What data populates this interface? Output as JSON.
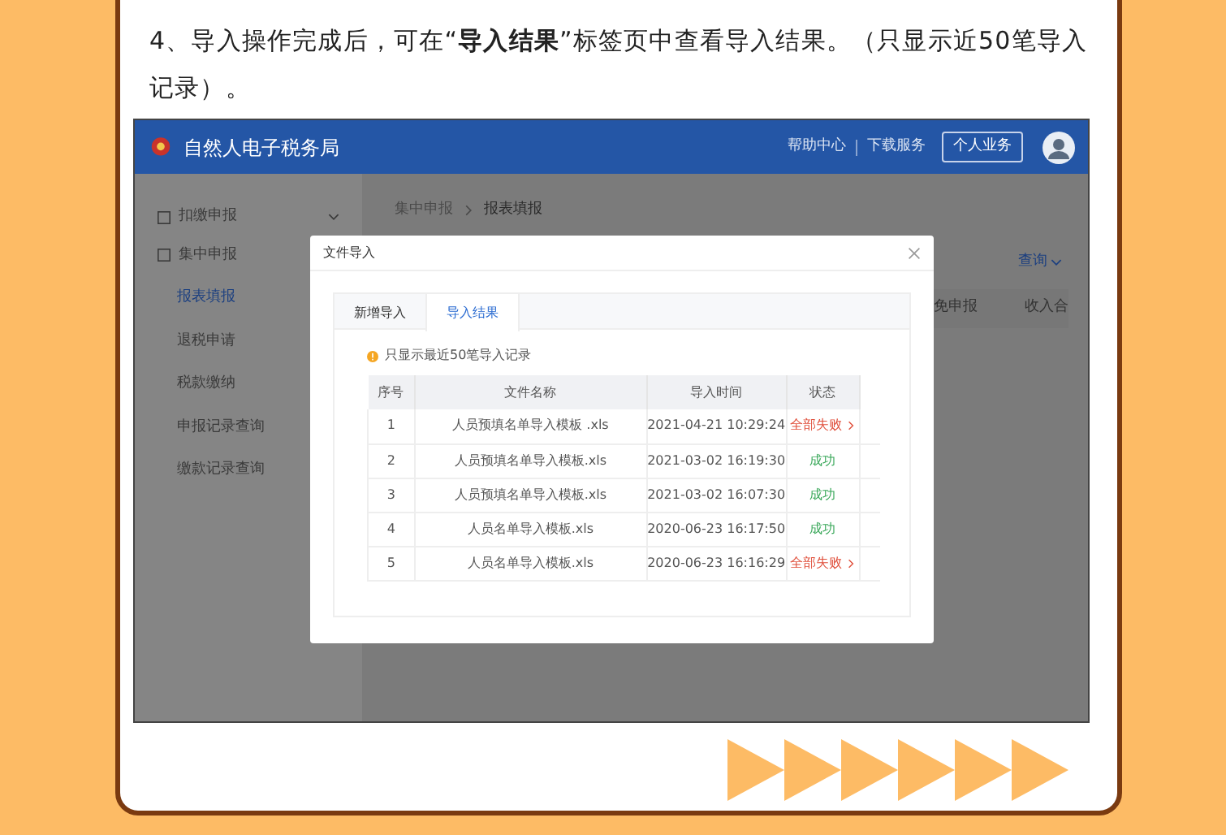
{
  "intro": "4、导入操作完成后，可在“**导入结果**”标签页中查看导入结果。（只显示近50笔导入记录）。",
  "app": {
    "title": "自然人电子税务局",
    "header_links": [
      "帮助中心",
      "下载服务"
    ],
    "account_button": "个人业务",
    "sidebar": [
      {
        "label": "扣缴申报"
      },
      {
        "label": "集中申报",
        "children": [
          {
            "label": "报表填报",
            "selected": true
          },
          {
            "label": "退税申请",
            "selected": false
          },
          {
            "label": "税款缴纳",
            "selected": false
          },
          {
            "label": "申报记录查询",
            "selected": false
          },
          {
            "label": "缴款记录查询",
            "selected": false
          }
        ]
      }
    ],
    "breadcrumb": [
      "集中申报",
      "报表填报"
    ],
    "query_link": "查询",
    "columns_partial": [
      "免申报",
      "收入合"
    ]
  },
  "modal": {
    "title": "文件导入",
    "tabs": [
      {
        "label": "新增导入",
        "selected": false
      },
      {
        "label": "导入结果",
        "selected": true
      }
    ],
    "notice": "只显示最近50笔导入记录",
    "columns": [
      "序号",
      "文件名称",
      "导入时间",
      "状态"
    ],
    "rows": [
      {
        "index": "1",
        "file": "人员预填名单导入模板 .xls",
        "time": "2021-04-21 10:29:24",
        "status": "全部失败",
        "kind": "failed"
      },
      {
        "index": "2",
        "file": "人员预填名单导入模板.xls",
        "time": "2021-03-02 16:19:30",
        "status": "成功",
        "kind": "success"
      },
      {
        "index": "3",
        "file": "人员预填名单导入模板.xls",
        "time": "2021-03-02 16:07:30",
        "status": "成功",
        "kind": "success"
      },
      {
        "index": "4",
        "file": "人员名单导入模板.xls",
        "time": "2020-06-23 16:17:50",
        "status": "成功",
        "kind": "success"
      },
      {
        "index": "5",
        "file": "人员名单导入模板.xls",
        "time": "2020-06-23 16:16:29",
        "status": "全部失败",
        "kind": "failed"
      }
    ]
  }
}
